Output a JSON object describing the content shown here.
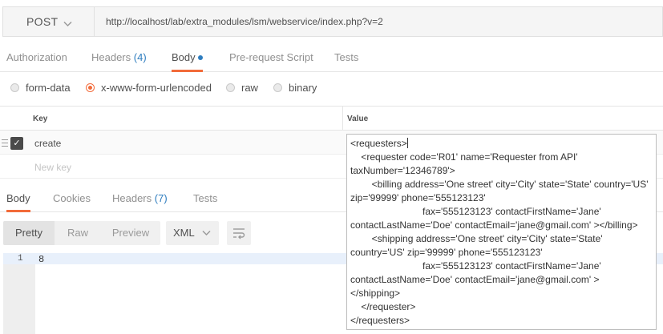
{
  "request": {
    "method": "POST",
    "url": "http://localhost/lab/extra_modules/lsm/webservice/index.php?v=2"
  },
  "request_tabs": [
    {
      "label": "Authorization"
    },
    {
      "label": "Headers",
      "count": "(4)"
    },
    {
      "label": "Body"
    },
    {
      "label": "Pre-request Script"
    },
    {
      "label": "Tests"
    }
  ],
  "body_types": [
    {
      "label": "form-data",
      "checked": false
    },
    {
      "label": "x-www-form-urlencoded",
      "checked": true
    },
    {
      "label": "raw",
      "checked": false
    },
    {
      "label": "binary",
      "checked": false
    }
  ],
  "kv": {
    "key_header": "Key",
    "value_header": "Value",
    "row_key": "create",
    "new_key_placeholder": "New key"
  },
  "value_text": [
    "<requesters>",
    "    <requester code='R01' name='Requester from API' taxNumber='12346789'>",
    "        <billing address='One street' city='City' state='State' country='US' zip='99999' phone='555123123'",
    "                           fax='555123123' contactFirstName='Jane' contactLastName='Doe' contactEmail='jane@gmail.com' ></billing>",
    "        <shipping address='One street' city='City' state='State' country='US' zip='99999' phone='555123123'",
    "                           fax='555123123' contactFirstName='Jane' contactLastName='Doe' contactEmail='jane@gmail.com' >",
    "</shipping>",
    "    </requester>",
    "</requesters>"
  ],
  "response_tabs": [
    {
      "label": "Body"
    },
    {
      "label": "Cookies"
    },
    {
      "label": "Headers",
      "count": "(7)"
    },
    {
      "label": "Tests"
    }
  ],
  "view_modes": {
    "pretty": "Pretty",
    "raw": "Raw",
    "preview": "Preview"
  },
  "format": "XML",
  "editor": {
    "line_number": "1",
    "line_text": "8"
  },
  "colors": {
    "accent": "#f26b3a",
    "link": "#2e7dbf"
  }
}
